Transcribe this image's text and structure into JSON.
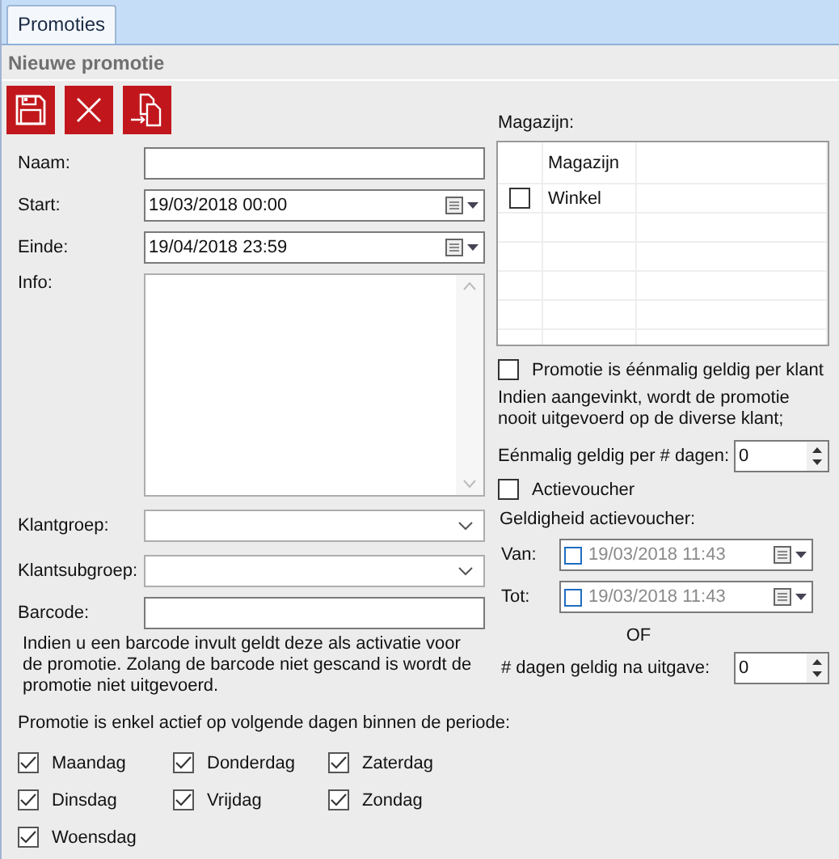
{
  "tabs": [
    {
      "label": "Promoties",
      "selected": true
    }
  ],
  "section_title": "Nieuwe promotie",
  "fields": [
    {
      "kind": "text",
      "label": "Naam:"
    },
    {
      "kind": "date",
      "label": "Start:",
      "value": "19/03/2018 00:00"
    },
    {
      "kind": "date",
      "label": "Einde:",
      "value": "19/04/2018 23:59"
    },
    {
      "kind": "textarea",
      "label": "Info:"
    },
    {
      "kind": "combo",
      "label": "Klantgroep:"
    },
    {
      "kind": "combo",
      "label": "Klantsubgroep:"
    },
    {
      "kind": "text",
      "label": "Barcode:"
    }
  ],
  "barcode_note": "Indien u een barcode invult geldt deze als activatie voor de promotie. Zolang de barcode niet gescand is wordt de promotie niet uitgevoerd.",
  "days_label": "Promotie is enkel actief op volgende dagen binnen de periode:",
  "day_columns": [
    [
      {
        "label": "Maandag",
        "checked": true
      },
      {
        "label": "Dinsdag",
        "checked": true
      },
      {
        "label": "Woensdag",
        "checked": true
      }
    ],
    [
      {
        "label": "Donderdag",
        "checked": true
      },
      {
        "label": "Vrijdag",
        "checked": true
      }
    ],
    [
      {
        "label": "Zaterdag",
        "checked": true
      },
      {
        "label": "Zondag",
        "checked": true
      }
    ]
  ],
  "magazijn": {
    "label": "Magazijn:",
    "column": "Magazijn",
    "rows": [
      {
        "name": "Winkel",
        "checked": false
      }
    ]
  },
  "once_per_customer": {
    "label": "Promotie is éénmalig geldig per klant",
    "checked": false
  },
  "once_note": "Indien aangevinkt, wordt de promotie nooit uitgevoerd op de diverse klant;",
  "once_days": {
    "label": "Eénmalig geldig per # dagen:",
    "value": "0"
  },
  "actievoucher": {
    "label": "Actievoucher",
    "checked": false
  },
  "validity": {
    "label": "Geldigheid actievoucher:",
    "from": {
      "label": "Van:",
      "value": "19/03/2018 11:43",
      "checked": false
    },
    "to": {
      "label": "Tot:",
      "value": "19/03/2018 11:43",
      "checked": false
    }
  },
  "or_label": "OF",
  "days_valid": {
    "label": "# dagen geldig na uitgave:",
    "value": "0"
  }
}
